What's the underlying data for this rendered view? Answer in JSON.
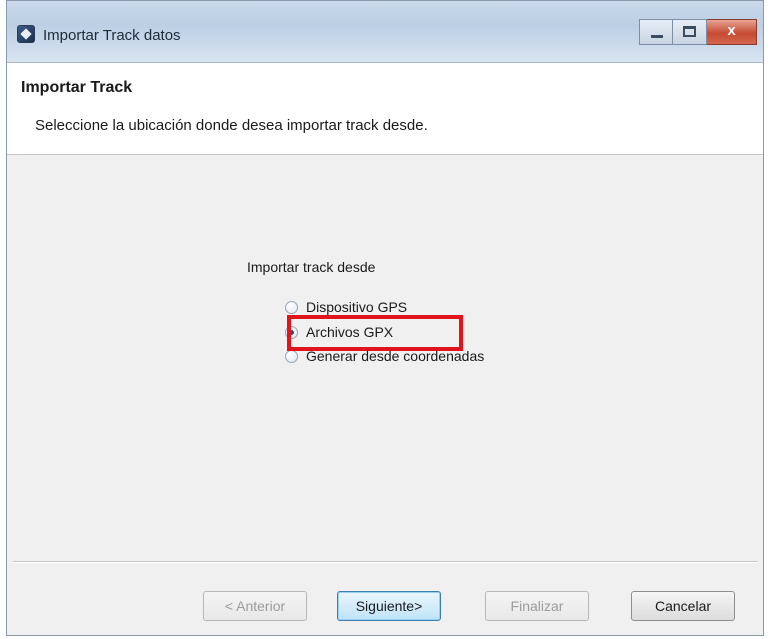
{
  "window": {
    "title": "Importar Track datos",
    "close_glyph": "x"
  },
  "header": {
    "title": "Importar Track",
    "description": "Seleccione la ubicación donde desea importar track desde."
  },
  "content": {
    "group_label": "Importar track desde",
    "options": [
      {
        "label": "Dispositivo GPS",
        "checked": false
      },
      {
        "label": "Archivos GPX",
        "checked": true
      },
      {
        "label": "Generar desde coordenadas",
        "checked": false
      }
    ],
    "highlight_color": "#e3131b"
  },
  "buttons": {
    "back": "< Anterior",
    "next": "Siguiente>",
    "finish": "Finalizar",
    "cancel": "Cancelar"
  }
}
